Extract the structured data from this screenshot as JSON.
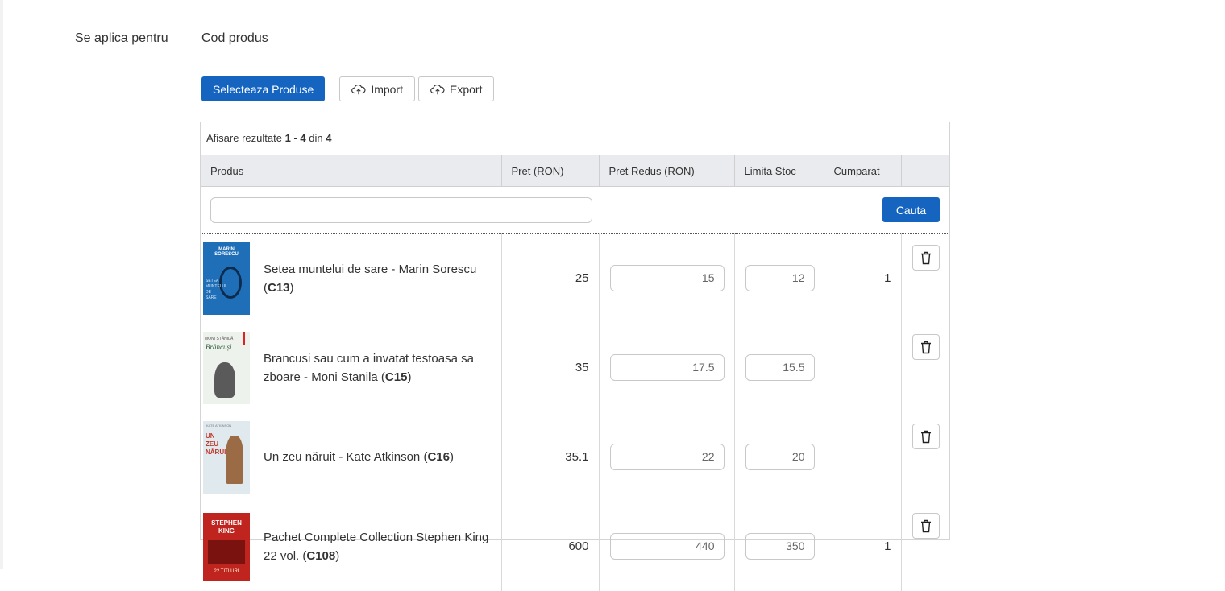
{
  "form": {
    "label": "Se aplica pentru",
    "value": "Cod produs"
  },
  "toolbar": {
    "select_label": "Selecteaza Produse",
    "import_label": "Import",
    "export_label": "Export",
    "import_icon": "cloud-upload-icon",
    "export_icon": "cloud-upload-icon"
  },
  "results": {
    "prefix": "Afisare rezultate",
    "from": "1",
    "sep": "-",
    "to": "4",
    "of_word": "din",
    "total": "4"
  },
  "table": {
    "headers": [
      "Produs",
      "Pret (RON)",
      "Pret Redus (RON)",
      "Limita Stoc",
      "Cumparat",
      ""
    ],
    "search_button": "Cauta",
    "search_value": "",
    "rows": [
      {
        "name": "Setea muntelui de sare - Marin Sorescu (",
        "code": "C13",
        "close": ")",
        "price": "25",
        "reduced": "15",
        "limit": "12",
        "bought": "1",
        "cover_title": "MARIN SORESCU",
        "cover_sub": "SETEA MUNTELUI DE SARE"
      },
      {
        "name": "Brancusi sau cum a invatat testoasa sa zboare - Moni Stanila (",
        "code": "C15",
        "close": ")",
        "price": "35",
        "reduced": "17.5",
        "limit": "15.5",
        "bought": "",
        "cover_title": "MONI STĂNILĂ",
        "cover_sub": "Brâncuși"
      },
      {
        "name": "Un zeu năruit - Kate Atkinson (",
        "code": "C16",
        "close": ")",
        "price": "35.1",
        "reduced": "22",
        "limit": "20",
        "bought": "",
        "cover_title": "KATE ATKINSON",
        "cover_sub": "UN ZEU NĂRUIT"
      },
      {
        "name": "Pachet Complete Collection Stephen King 22 vol. (",
        "code": "C108",
        "close": ")",
        "price": "600",
        "reduced": "440",
        "limit": "350",
        "bought": "1",
        "cover_title": "STEPHEN KING",
        "cover_sub": "22 TITLURI"
      }
    ]
  },
  "colors": {
    "primary": "#1565c0",
    "header_bg": "#e9ebee",
    "border": "#d4d4d4"
  }
}
